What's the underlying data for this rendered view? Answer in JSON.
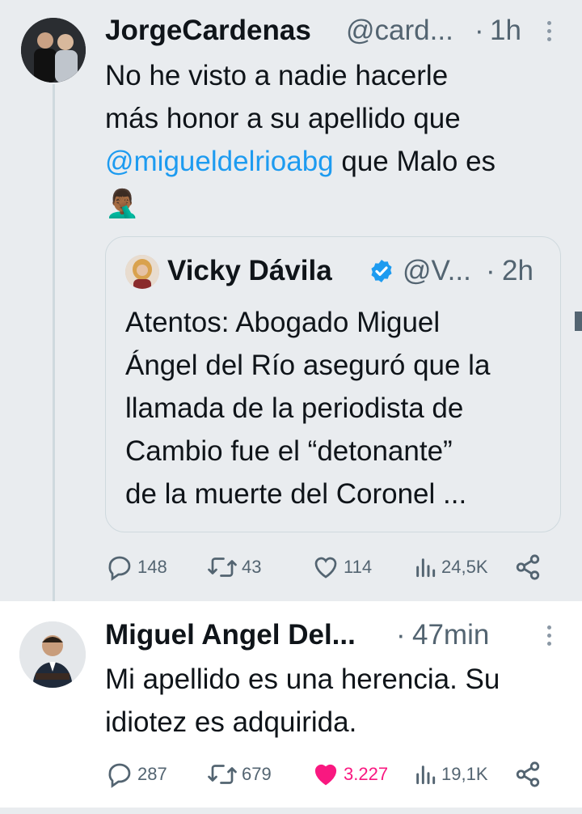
{
  "tweet1": {
    "display_name": "JorgeCardenas",
    "handle": "@card...",
    "separator": "·",
    "time": "1h",
    "text_line1": "No he visto a nadie hacerle",
    "text_line2": "más honor a su apellido que",
    "mention": "@migueldelrioabg",
    "text_after_mention": " que Malo es",
    "emoji": "🤦🏾‍♂️",
    "quote": {
      "display_name": "Vicky Dávila",
      "handle": "@V...",
      "separator": "·",
      "time": "2h",
      "lines": [
        "Atentos: Abogado Miguel",
        "Ángel del Río aseguró que la",
        "llamada de la periodista de",
        "Cambio fue el “detonante”",
        "de la muerte del Coronel ..."
      ]
    },
    "actions": {
      "replies": "148",
      "retweets": "43",
      "likes": "114",
      "views": "24,5K"
    }
  },
  "tweet2": {
    "display_name": "Miguel Angel Del...",
    "separator": "·",
    "time": "47min",
    "lines": [
      "Mi apellido es una herencia. Su",
      "idiotez es adquirida."
    ],
    "actions": {
      "replies": "287",
      "retweets": "679",
      "likes": "3.227",
      "views": "19,1K"
    }
  },
  "colors": {
    "accent": "#1d9bf0",
    "like": "#f91880",
    "muted": "#536471",
    "verified": "#1d9bf0"
  },
  "icons": [
    "reply-icon",
    "retweet-icon",
    "like-icon",
    "views-icon",
    "share-icon",
    "verified-badge-icon",
    "more-icon"
  ]
}
